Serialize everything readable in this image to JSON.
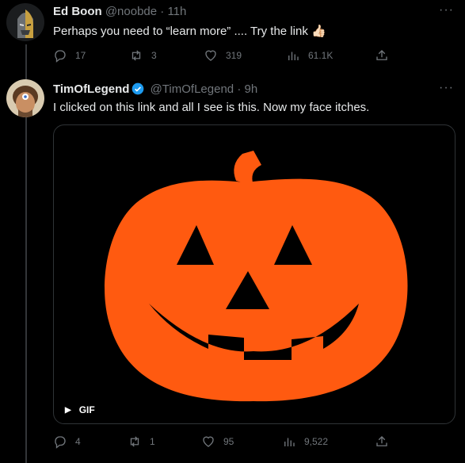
{
  "tweet1": {
    "name": "Ed Boon",
    "handle": "@noobde",
    "time": "· 11h",
    "text": "Perhaps you need to “learn more” .... Try the link 👍🏻",
    "more": "···",
    "replies": "17",
    "retweets": "3",
    "likes": "319",
    "views": "61.1K"
  },
  "tweet2": {
    "name": "TimOfLegend",
    "handle": "@TimOfLegend",
    "time": "· 9h",
    "text": "I clicked on this link and all I see is this. Now my face itches.",
    "more": "···",
    "media_badge": "GIF",
    "replies": "4",
    "retweets": "1",
    "likes": "95",
    "views": "9,522"
  },
  "colors": {
    "pumpkin": "#ff5a10",
    "verified": "#1d9bf0",
    "muted": "#71767b"
  }
}
